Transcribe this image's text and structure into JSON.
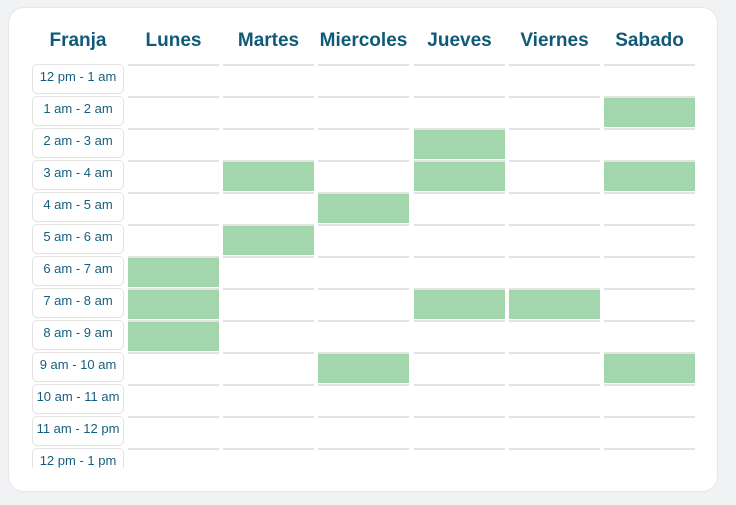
{
  "header": {
    "slot_column": "Franja",
    "days": [
      "Lunes",
      "Martes",
      "Miercoles",
      "Jueves",
      "Viernes",
      "Sabado"
    ]
  },
  "slots": [
    "12 pm - 1 am",
    "1 am - 2 am",
    "2 am - 3 am",
    "3 am - 4 am",
    "4 am - 5 am",
    "5 am - 6 am",
    "6 am - 7 am",
    "7 am - 8 am",
    "8 am - 9 am",
    "9 am - 10 am",
    "10 am - 11 am",
    "11 am - 12 pm",
    "12 pm - 1 pm"
  ],
  "selected": {
    "Lunes": [
      6,
      7,
      8
    ],
    "Martes": [
      3,
      5
    ],
    "Miercoles": [
      4,
      9
    ],
    "Jueves": [
      2,
      3,
      7
    ],
    "Viernes": [
      7
    ],
    "Sabado": [
      1,
      3,
      9
    ]
  },
  "colors": {
    "selected": "#a3d6ad",
    "header": "#0f5a78"
  }
}
